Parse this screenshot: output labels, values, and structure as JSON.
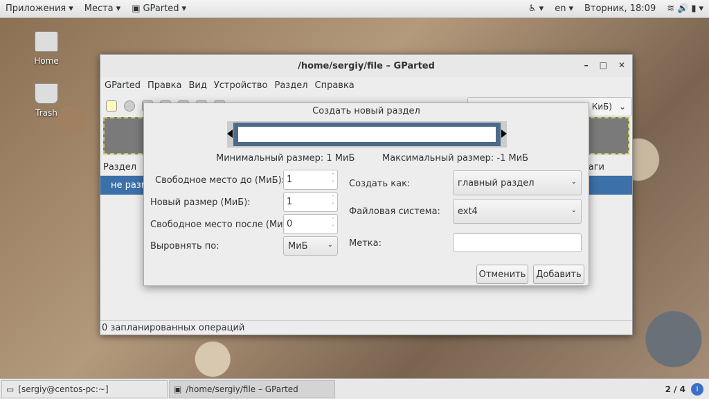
{
  "topbar": {
    "apps": "Приложения",
    "places": "Места",
    "app": "GParted",
    "lang": "en",
    "clock": "Вторник, 18:09"
  },
  "desktop": {
    "home": "Home",
    "trash": "Trash"
  },
  "window": {
    "title": "/home/sergiy/file – GParted",
    "menu": [
      "GParted",
      "Правка",
      "Вид",
      "Устройство",
      "Раздел",
      "Справка"
    ],
    "device": "/home/sergiy/file (500.00 КиБ)",
    "col_partition": "Раздел",
    "col_flags": "Флаги",
    "row": "не размечено",
    "status": "0 запланированных операций"
  },
  "dialog": {
    "title": "Создать новый раздел",
    "min": "Минимальный размер: 1 МиБ",
    "max": "Максимальный размер: -1 МиБ",
    "free_before_label": "Свободное место до (МиБ):",
    "free_before": "1",
    "new_size_label": "Новый размер (МиБ):",
    "new_size": "1",
    "free_after_label": "Свободное место после (МиБ):",
    "free_after": "0",
    "align_label": "Выровнять по:",
    "align": "МиБ",
    "create_as_label": "Создать как:",
    "create_as": "главный раздел",
    "fs_label": "Файловая система:",
    "fs": "ext4",
    "label_label": "Метка:",
    "label_value": "",
    "cancel": "Отменить",
    "add": "Добавить"
  },
  "taskbar": {
    "terminal": "[sergiy@centos-pc:~]",
    "gparted": "/home/sergiy/file – GParted",
    "workspace": "2 / 4"
  }
}
